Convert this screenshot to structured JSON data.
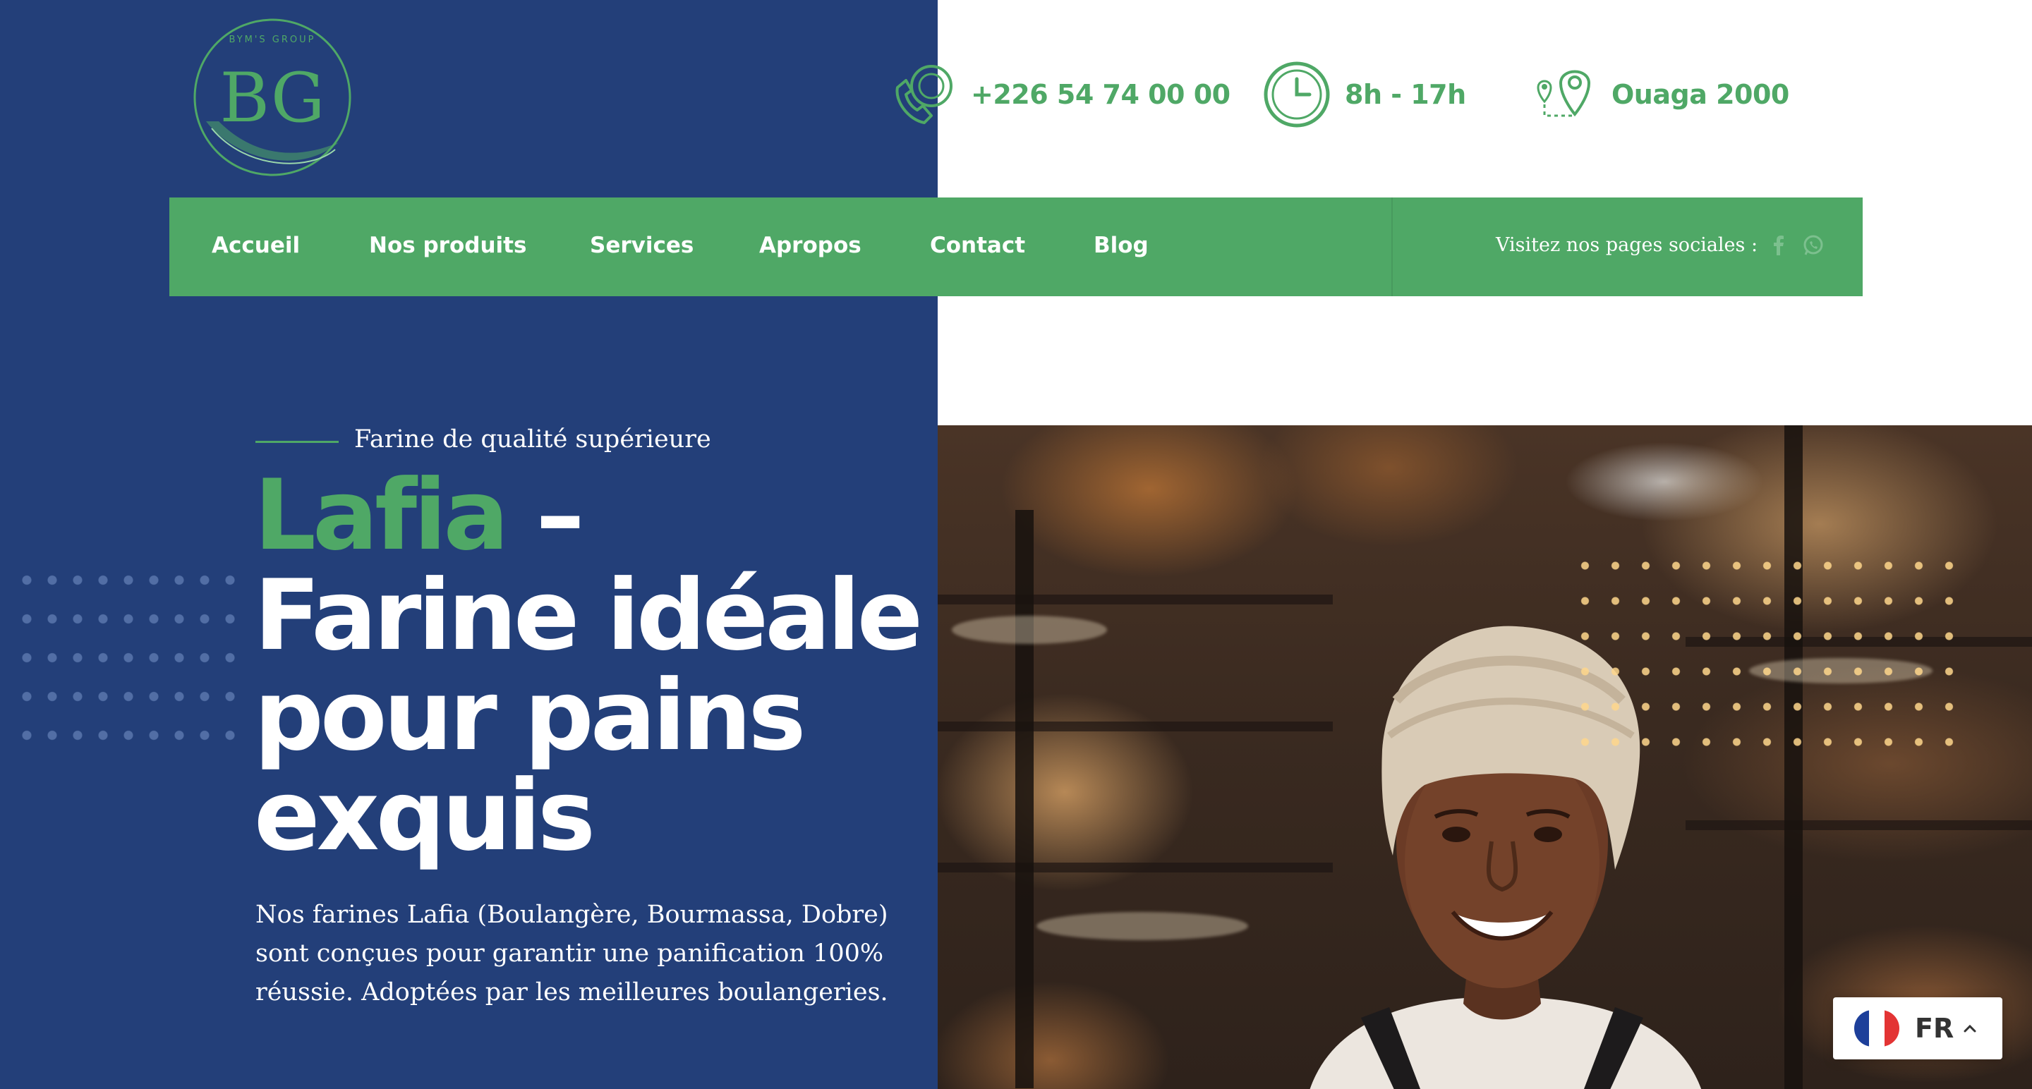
{
  "brand": {
    "logo_text": "BG",
    "logo_ring_text": "BYM'S GROUP"
  },
  "topbar": {
    "phone": "+226 54 74 00 00",
    "hours": "8h - 17h",
    "location": "Ouaga 2000"
  },
  "nav": {
    "items": [
      {
        "label": "Accueil"
      },
      {
        "label": "Nos produits"
      },
      {
        "label": "Services"
      },
      {
        "label": "Apropos"
      },
      {
        "label": "Contact"
      },
      {
        "label": "Blog"
      }
    ],
    "social_label": "Visitez nos pages sociales :",
    "social_icons": [
      "facebook-icon",
      "whatsapp-icon"
    ]
  },
  "hero": {
    "eyebrow": "Farine de qualité supérieure",
    "headline_accent": "Lafia",
    "headline_dash": " –",
    "headline_rest": "Farine idéale pour pains exquis",
    "lead": "Nos farines Lafia (Boulangère, Bourmassa, Dobre) sont conçues pour garantir une panification 100% réussie. Adoptées par les meilleures boulangeries."
  },
  "language": {
    "code": "FR",
    "flag": "france-flag-icon"
  },
  "colors": {
    "navy": "#233f79",
    "green": "#4fa866",
    "white": "#ffffff"
  }
}
